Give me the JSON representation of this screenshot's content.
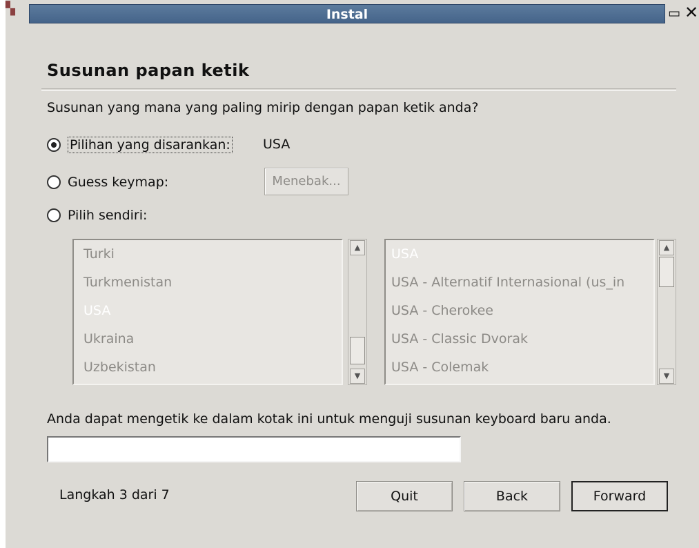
{
  "window": {
    "title": "Instal"
  },
  "page": {
    "heading": "Susunan papan ketik",
    "question": "Susunan yang mana yang paling mirip dengan papan ketik anda?"
  },
  "options": {
    "suggested_label": "Pilihan yang disarankan:",
    "suggested_value": "USA",
    "guess_label": "Guess keymap:",
    "guess_button": "Menebak...",
    "manual_label": "Pilih sendiri:"
  },
  "countries": [
    "Turki",
    "Turkmenistan",
    "USA",
    "Ukraina",
    "Uzbekistan"
  ],
  "variants": [
    "USA",
    "USA - Alternatif Internasional (us_in",
    "USA - Cherokee",
    "USA - Classic Dvorak",
    "USA - Colemak"
  ],
  "test": {
    "hint": "Anda dapat mengetik ke dalam kotak ini untuk menguji susunan keyboard baru anda.",
    "value": ""
  },
  "footer": {
    "step": "Langkah 3 dari 7",
    "quit_label": "Quit",
    "back_label": "Back",
    "forward_label": "Forward"
  }
}
